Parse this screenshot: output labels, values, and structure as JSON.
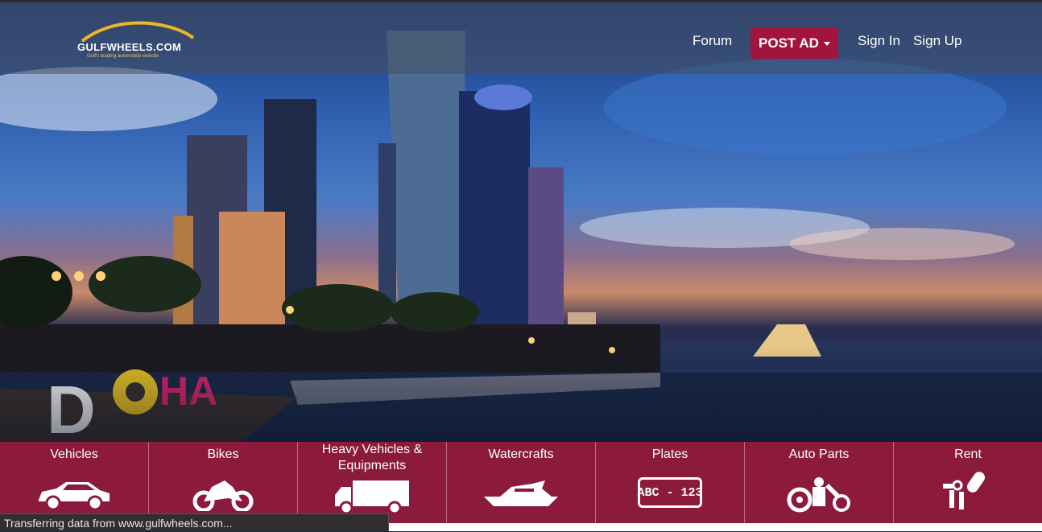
{
  "brand": {
    "name": "GULFWHEELS.COM",
    "tagline": "Gulf's leading automobile website",
    "accent": "#a3133f",
    "category_bar": "#8b1a3c"
  },
  "nav": {
    "forum": "Forum",
    "post_ad": "POST AD",
    "sign_in": "Sign In",
    "sign_up": "Sign Up"
  },
  "hero": {
    "sign_text": "DOHA"
  },
  "categories": [
    {
      "label": "Vehicles",
      "icon": "car-icon"
    },
    {
      "label": "Bikes",
      "icon": "motorbike-icon"
    },
    {
      "label": "Heavy Vehicles & Equipments",
      "icon": "truck-icon"
    },
    {
      "label": "Watercrafts",
      "icon": "yacht-icon"
    },
    {
      "label": "Plates",
      "icon": "license-plate-icon",
      "plate_text": "ABC - 123"
    },
    {
      "label": "Auto Parts",
      "icon": "auto-parts-icon"
    },
    {
      "label": "Rent",
      "icon": "car-keys-icon"
    }
  ],
  "status": {
    "text": "Transferring data from www.gulfwheels.com..."
  }
}
